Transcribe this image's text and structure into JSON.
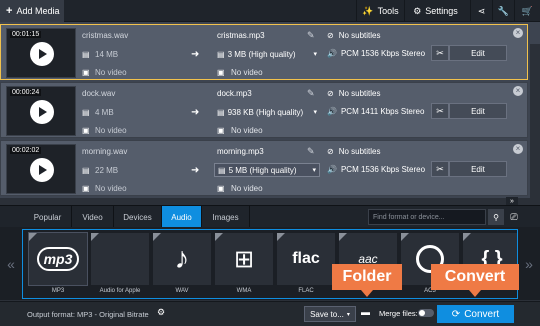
{
  "toolbar": {
    "add_media": "Add Media",
    "tools": "Tools",
    "settings": "Settings"
  },
  "files": [
    {
      "duration": "00:01:15",
      "source_name": "cristmas.wav",
      "source_size": "14 MB",
      "source_video": "No video",
      "output_name": "cristmas.mp3",
      "quality": "3 MB (High quality)",
      "output_video": "No video",
      "subtitles": "No subtitles",
      "audio": "PCM 1536 Kbps Stereo",
      "edit": "Edit",
      "selected": true
    },
    {
      "duration": "00:00:24",
      "source_name": "dock.wav",
      "source_size": "4 MB",
      "source_video": "No video",
      "output_name": "dock.mp3",
      "quality": "938 KB (High quality)",
      "output_video": "No video",
      "subtitles": "No subtitles",
      "audio": "PCM 1411 Kbps Stereo",
      "edit": "Edit",
      "selected": false
    },
    {
      "duration": "00:02:02",
      "source_name": "morning.wav",
      "source_size": "22 MB",
      "source_video": "No video",
      "output_name": "morning.mp3",
      "quality": "5 MB (High quality)",
      "output_video": "No video",
      "subtitles": "No subtitles",
      "audio": "PCM 1536 Kbps Stereo",
      "edit": "Edit",
      "selected": false
    }
  ],
  "tabs": [
    {
      "label": "Popular",
      "active": false
    },
    {
      "label": "Video",
      "active": false
    },
    {
      "label": "Devices",
      "active": false
    },
    {
      "label": "Audio",
      "active": true
    },
    {
      "label": "Images",
      "active": false
    }
  ],
  "search": {
    "placeholder": "Find format or device..."
  },
  "formats": [
    {
      "label": "MP3",
      "icon": "mp3-logo-icon",
      "tile_text": "mp3"
    },
    {
      "label": "Audio for Apple",
      "icon": "apple-icon",
      "tile_text": ""
    },
    {
      "label": "WAV",
      "icon": "music-note-icon",
      "tile_text": ""
    },
    {
      "label": "WMA",
      "icon": "windows-icon",
      "tile_text": ""
    },
    {
      "label": "FLAC",
      "icon": "flac-logo-icon",
      "tile_text": "flac"
    },
    {
      "label": "",
      "icon": "aac-logo-icon",
      "tile_text": "aac"
    },
    {
      "label": "AC3",
      "icon": "ac3-play-icon",
      "tile_text": ""
    },
    {
      "label": "",
      "icon": "braces-icon",
      "tile_text": "{ }"
    }
  ],
  "bottom": {
    "output_format": "Output format: MP3 - Original Bitrate",
    "save_to": "Save to...",
    "merge_files": "Merge files:",
    "convert": "Convert"
  },
  "callouts": {
    "folder": "Folder",
    "convert": "Convert"
  },
  "colors": {
    "accent": "#0f8ee0",
    "callout": "#ef7a45",
    "selection": "#f2c24c"
  }
}
